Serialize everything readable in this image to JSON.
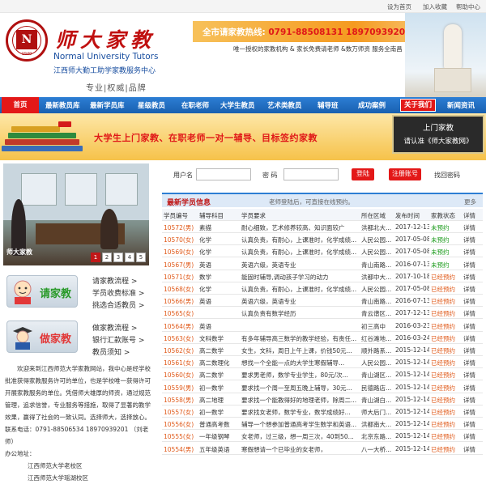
{
  "topbar": {
    "home": "设为首页",
    "fav": "加入收藏",
    "help": "帮助中心"
  },
  "brand": {
    "name": "师大家教",
    "en": "Normal University Tutors",
    "sub": "江西师大勤工助学家教服务中心",
    "seal_year": "1940",
    "tagline": "专业|权威|品牌"
  },
  "hotline": {
    "label": "全市请家教热线:",
    "phone1": "0791-88508131",
    "phone2": "18970939201（刘）"
  },
  "service": "唯一授权的家教机构 & 家长免费请老师 &数万师资    服务全南昌",
  "nav": {
    "home": "首页",
    "items": [
      "最新教员库",
      "最新学员库",
      "星级教员",
      "在职老师",
      "大学生教员",
      "艺术类教员",
      "辅导班",
      "成功案例",
      "关于我们",
      "新闻资讯"
    ],
    "active_index": 8
  },
  "banner": {
    "text": "大学生上门家教、在职老师一对一辅导、目标签约家教",
    "box_line1": "上门家教",
    "box_line2": "请认准《师大家教网》"
  },
  "photo": {
    "caption": "师大家教",
    "slides": [
      "1",
      "2",
      "3",
      "4",
      "5"
    ],
    "active_slide": 1
  },
  "buttons": {
    "request": "请家教",
    "tutor": "做家教"
  },
  "side_links": {
    "request": [
      "请家教流程 >",
      "学员收费标准 >",
      "挑选合适教员 >"
    ],
    "tutor": [
      "做家教流程 >",
      "银行汇款账号 >",
      "教员须知 >"
    ]
  },
  "intro": {
    "text": "欢迎来到江西师范大学家教网站，我中心是经学校批准获得家教服务许可的单位，也是学校唯一获得许可开展家教服务的单位。凭借师大雄厚的师资，通过规范管理，追求信誉，专业服务等措施，取得了显著的教学效果，赢得了社会的一致认同。选择师大，选择放心。",
    "contact": "联系电话：0791-88506534 18970939201 （刘老师）",
    "address_label": "办公地址：",
    "address1": "江西师范大学老校区",
    "address2": "江西师范大学瑶湖校区"
  },
  "login": {
    "user_label": "用户名",
    "pwd_label": "密  码",
    "login_btn": "登陆",
    "register_btn": "注册账号",
    "forgot": "找回密码"
  },
  "list": {
    "title": "最新学员信息",
    "notice": "老师登陆后，可直接在线预约。",
    "more": "更多",
    "columns": [
      "学员编号",
      "辅导科目",
      "学员要求",
      "所在区域",
      "发布时间",
      "家教状态",
      "详情"
    ],
    "rows": [
      [
        "10572(男)",
        "素描",
        "耐心细致，艺术修养较高、知识面较广",
        "洪都北大...",
        "2017-12-13",
        "未预约",
        "详情"
      ],
      [
        "10570(女)",
        "化学",
        "认真负责，有耐心，上课准时，化学成绩...",
        "人民公园...",
        "2017-05-08",
        "未预约",
        "详情"
      ],
      [
        "10569(女)",
        "化学",
        "认真负责，有耐心，上课准时，化学成绩...",
        "人民公园...",
        "2017-05-08",
        "未预约",
        "详情"
      ],
      [
        "10567(男)",
        "英语",
        "英语六级，英语专业",
        "青山南路...",
        "2016-07-13",
        "未预约",
        "详情"
      ],
      [
        "10571(女)",
        "数学",
        "能固时辅导,调动孩子学习的动力",
        "洪都中大...",
        "2017-10-18",
        "已经预约",
        "详情"
      ],
      [
        "10568(女)",
        "化学",
        "认真负责，有耐心，上课准时，化学成绩...",
        "人民公园...",
        "2017-05-08",
        "已经预约",
        "详情"
      ],
      [
        "10566(男)",
        "英语",
        "英语六级，英语专业",
        "青山南路...",
        "2016-07-13",
        "已经预约",
        "详情"
      ],
      [
        "10565(女)",
        "",
        "认真负责有数学经历",
        "青云谱区...",
        "2017-12-13",
        "已经预约",
        "详情"
      ],
      [
        "10564(男)",
        "英语",
        "",
        "初三高中",
        "2016-03-23",
        "已经预约",
        "详情"
      ],
      [
        "10563(女)",
        "文科数学",
        "有多年辅导高三数学的教学经验，有责任...",
        "红谷滩地...",
        "2016-03-24",
        "已经预约",
        "详情"
      ],
      [
        "10562(女)",
        "高二数学",
        "女生，文科，周日上午上课，价钱50元...",
        "顺外路系...",
        "2015-12-14",
        "已经预约",
        "详情"
      ],
      [
        "10561(女)",
        "高二数理化",
        "想找一个全能一点的大学生寒假辅导...",
        "人民公园...",
        "2015-12-14",
        "已经预约",
        "详情"
      ],
      [
        "10560(女)",
        "高二数学",
        "要求男老师，数学专业学生，80元/次...",
        "青山湖区...",
        "2015-12-14",
        "已经预约",
        "详情"
      ],
      [
        "10559(男)",
        "初一数学",
        "要求找一个周一至周五晚上辅导，30元...",
        "民德路店...",
        "2015-12-14",
        "已经预约",
        "详情"
      ],
      [
        "10558(男)",
        "高二地理",
        "要求找一个能教得好的地理老师，除周二...",
        "青山湖白...",
        "2015-12-14",
        "已经预约",
        "详情"
      ],
      [
        "10557(女)",
        "初一数学",
        "要求找女老师，数学专业，数学成绩好...",
        "师大后门...",
        "2015-12-14",
        "已经预约",
        "详情"
      ],
      [
        "10556(女)",
        "普通高考数",
        "辅导一个想参加普通高考学生数学和英语...",
        "洪都南大...",
        "2015-12-14",
        "已经预约",
        "详情"
      ],
      [
        "10555(女)",
        "一年级钢琴",
        "女老师，过三级，想一周三次，40到50...",
        "北京东路...",
        "2015-12-14",
        "已经预约",
        "详情"
      ],
      [
        "10554(男)",
        "五年级英语",
        "寒假想请一个已毕业的女老师，",
        "八一大桥...",
        "2015-12-14",
        "已经预约",
        "详情"
      ]
    ]
  },
  "colors": {
    "nav": "#1f6cc0",
    "red": "#e31818",
    "orange": "#f59a20",
    "green": "#1a9a1a"
  }
}
